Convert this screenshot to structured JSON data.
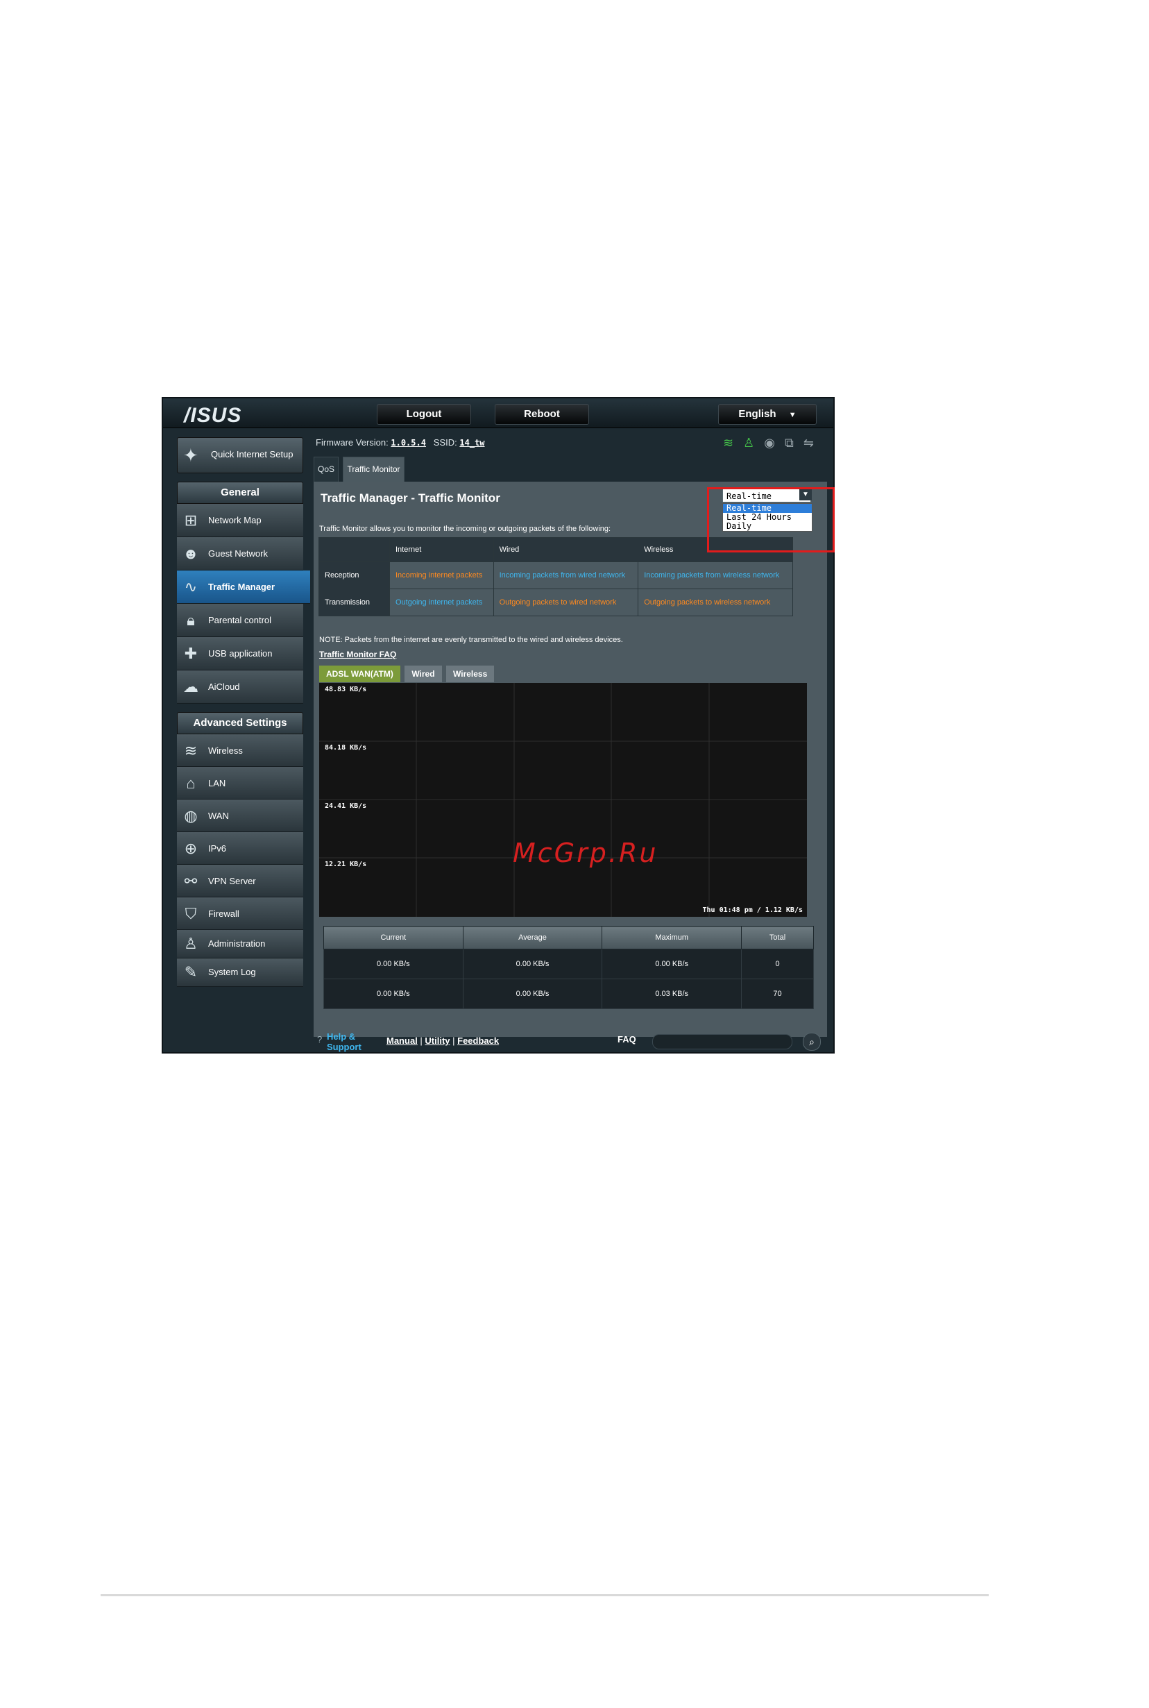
{
  "header": {
    "logo": "/ISUS",
    "logout": "Logout",
    "reboot": "Reboot",
    "language": "English"
  },
  "info": {
    "firmware_label": "Firmware Version:",
    "firmware_value": "1.0.5.4",
    "ssid_label": "SSID:",
    "ssid_value": "14_tw"
  },
  "sidebar": {
    "quick_setup": "Quick Internet Setup",
    "general_title": "General",
    "general": [
      {
        "label": "Network Map",
        "icon": "network-map-icon"
      },
      {
        "label": "Guest Network",
        "icon": "guest-network-icon"
      },
      {
        "label": "Traffic Manager",
        "icon": "traffic-manager-icon"
      },
      {
        "label": "Parental control",
        "icon": "lock-icon"
      },
      {
        "label": "USB application",
        "icon": "puzzle-icon"
      },
      {
        "label": "AiCloud",
        "icon": "cloud-icon"
      }
    ],
    "advanced_title": "Advanced Settings",
    "advanced": [
      {
        "label": "Wireless",
        "icon": "wifi-icon"
      },
      {
        "label": "LAN",
        "icon": "home-icon"
      },
      {
        "label": "WAN",
        "icon": "globe-icon"
      },
      {
        "label": "IPv6",
        "icon": "ipv6-icon"
      },
      {
        "label": "VPN Server",
        "icon": "vpn-icon"
      },
      {
        "label": "Firewall",
        "icon": "shield-icon"
      },
      {
        "label": "Administration",
        "icon": "user-icon"
      },
      {
        "label": "System Log",
        "icon": "log-icon"
      }
    ]
  },
  "tabs": [
    "QoS",
    "Traffic Monitor"
  ],
  "content": {
    "title": "Traffic Manager - Traffic Monitor",
    "description": "Traffic Monitor allows you to monitor the incoming or outgoing packets of the following:",
    "select_value": "Real-time",
    "select_options": [
      "Real-time",
      "Last 24 Hours",
      "Daily"
    ],
    "table": {
      "headers": [
        "",
        "Internet",
        "Wired",
        "Wireless"
      ],
      "rows": [
        {
          "label": "Reception",
          "internet": "Incoming internet packets",
          "wired": "Incoming packets from wired network",
          "wireless": "Incoming packets from wireless network"
        },
        {
          "label": "Transmission",
          "internet": "Outgoing internet packets",
          "wired": "Outgoing packets to wired network",
          "wireless": "Outgoing packets to wireless network"
        }
      ]
    },
    "note": "NOTE: Packets from the internet are evenly transmitted to the wired and wireless devices.",
    "faq_link": "Traffic Monitor FAQ",
    "graph_tabs": [
      "ADSL WAN(ATM)",
      "Wired",
      "Wireless"
    ],
    "graph": {
      "y_labels": [
        "48.83 KB/s",
        "84.18 KB/s",
        "24.41 KB/s",
        "12.21 KB/s"
      ],
      "timestamp": "Thu 01:48 pm / 1.12 KB/s"
    },
    "stats": {
      "headers": [
        "Current",
        "Average",
        "Maximum",
        "Total"
      ],
      "rows": [
        {
          "current": "0.00 KB/s",
          "average": "0.00 KB/s",
          "maximum": "0.00 KB/s",
          "total": "0"
        },
        {
          "current": "0.00 KB/s",
          "average": "0.00 KB/s",
          "maximum": "0.03 KB/s",
          "total": "70"
        }
      ]
    }
  },
  "footer": {
    "help": "Help & Support",
    "manual": "Manual",
    "utility": "Utility",
    "feedback": "Feedback",
    "faq": "FAQ"
  },
  "watermark": "McGrp.Ru"
}
